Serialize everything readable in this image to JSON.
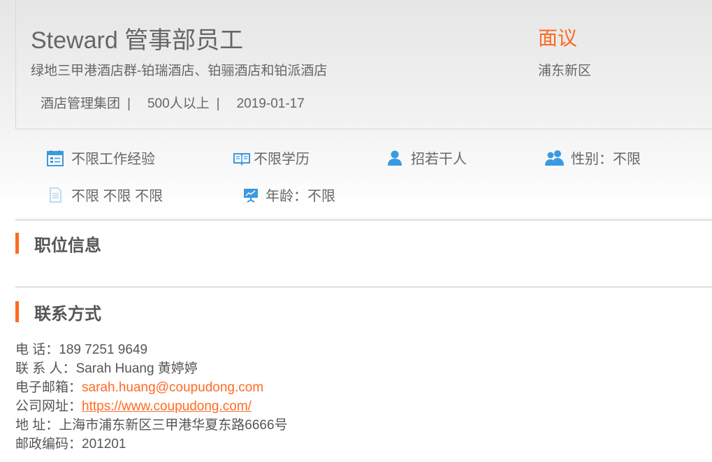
{
  "job": {
    "title": "Steward 管事部员工",
    "salary": "面议",
    "company": "绿地三甲港酒店群-铂瑞酒店、铂骊酒店和铂派酒店",
    "district": "浦东新区",
    "meta": {
      "industry": "酒店管理集团",
      "size": "500人以上",
      "date": "2019-01-17",
      "separator": "|"
    }
  },
  "requirements": {
    "experience": "不限工作经验",
    "education": "不限学历",
    "headcount": "招若干人",
    "gender": "性别：不限",
    "other": "不限 不限 不限",
    "age": "年龄：不限"
  },
  "sections": {
    "position_info": "职位信息",
    "contact_info": "联系方式"
  },
  "contact": {
    "phone_label": "电 话：",
    "phone": "189 7251 9649",
    "person_label": "联 系 人：",
    "person": "Sarah Huang 黄婷婷",
    "email_label": "电子邮箱：",
    "email": "sarah.huang@coupudong.com",
    "website_label": "公司网址：",
    "website": "https://www.coupudong.com/",
    "address_label": "地 址：",
    "address": "上海市浦东新区三甲港华夏东路6666号",
    "postcode_label": "邮政编码：",
    "postcode": "201201"
  },
  "colors": {
    "accent": "#ff6a22",
    "icon_blue": "#3a9ae0"
  }
}
